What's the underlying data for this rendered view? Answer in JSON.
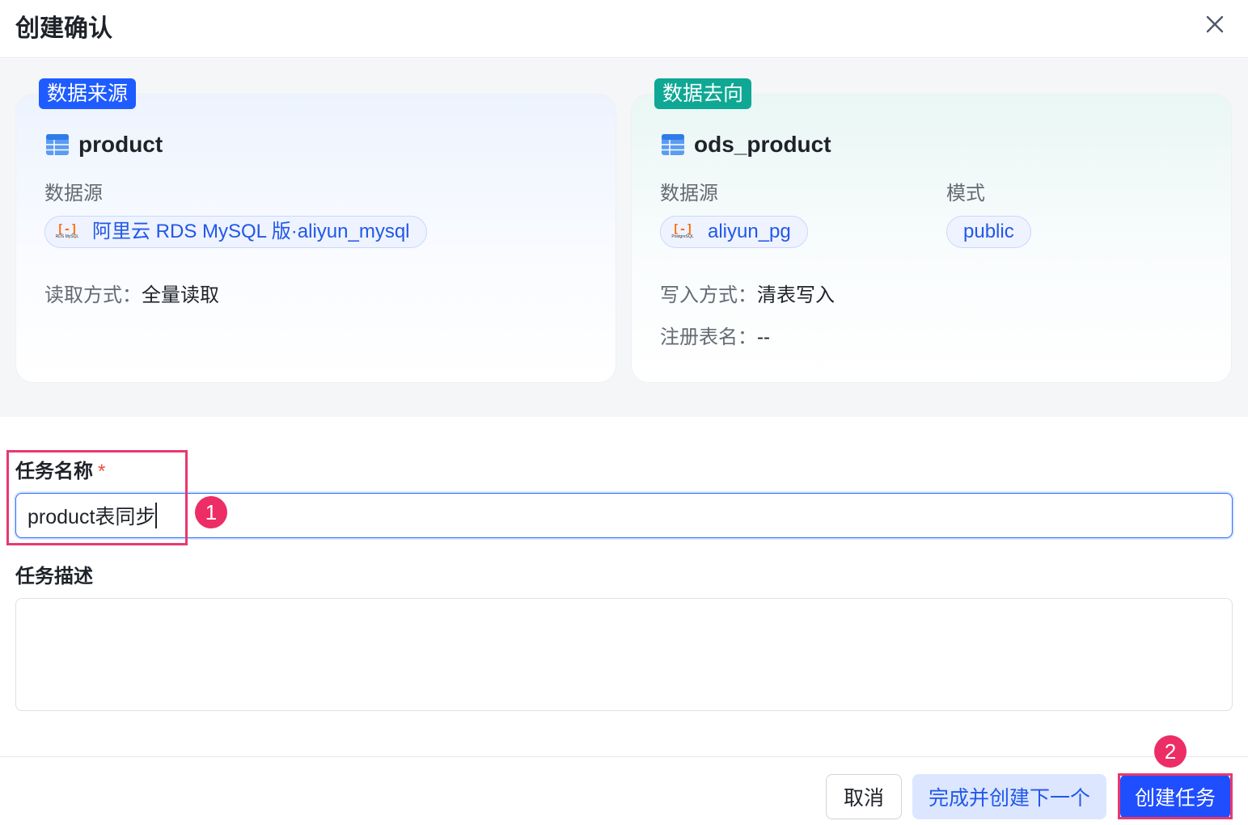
{
  "dialog": {
    "title": "创建确认"
  },
  "source": {
    "tag": "数据来源",
    "table": "product",
    "datasource_label": "数据源",
    "datasource_value": "阿里云 RDS MySQL 版·aliyun_mysql",
    "datasource_logo_text": "RDS MySQL",
    "read_mode_label": "读取方式：",
    "read_mode_value": "全量读取"
  },
  "target": {
    "tag": "数据去向",
    "table": "ods_product",
    "datasource_label": "数据源",
    "datasource_value": "aliyun_pg",
    "datasource_logo_text": "PostgreSQL",
    "schema_label": "模式",
    "schema_value": "public",
    "write_mode_label": "写入方式：",
    "write_mode_value": "清表写入",
    "register_label": "注册表名：",
    "register_value": "--"
  },
  "form": {
    "name_label": "任务名称",
    "required_mark": "*",
    "name_value": "product表同步",
    "desc_label": "任务描述",
    "desc_value": ""
  },
  "annotations": {
    "step1": "1",
    "step2": "2",
    "highlight_color": "#e8386f"
  },
  "footer": {
    "cancel": "取消",
    "create_next": "完成并创建下一个",
    "create": "创建任务"
  },
  "colors": {
    "primary": "#1f4eff",
    "source_tag": "#1f5cff",
    "target_tag": "#0ea894",
    "alibaba_orange": "#ff6a00"
  }
}
